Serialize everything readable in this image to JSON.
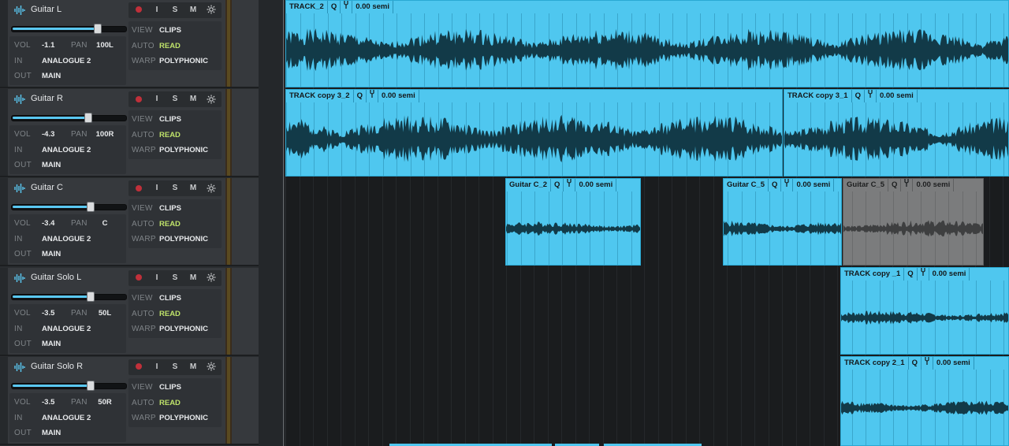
{
  "tracks": [
    {
      "name": "Guitar L",
      "vol_label": "VOL",
      "vol": "-1.1",
      "pan_label": "PAN",
      "pan": "100L",
      "in_label": "IN",
      "in": "ANALOGUE 2",
      "out_label": "OUT",
      "out": "MAIN",
      "view_label": "VIEW",
      "view": "CLIPS",
      "auto_label": "AUTO",
      "auto": "READ",
      "warp_label": "WARP",
      "warp": "POLYPHONIC",
      "buttons": {
        "i": "I",
        "s": "S",
        "m": "M"
      },
      "fader_level": 0.76
    },
    {
      "name": "Guitar R",
      "vol_label": "VOL",
      "vol": "-4.3",
      "pan_label": "PAN",
      "pan": "100R",
      "in_label": "IN",
      "in": "ANALOGUE 2",
      "out_label": "OUT",
      "out": "MAIN",
      "view_label": "VIEW",
      "view": "CLIPS",
      "auto_label": "AUTO",
      "auto": "READ",
      "warp_label": "WARP",
      "warp": "POLYPHONIC",
      "buttons": {
        "i": "I",
        "s": "S",
        "m": "M"
      },
      "fader_level": 0.68
    },
    {
      "name": "Guitar C",
      "vol_label": "VOL",
      "vol": "-3.4",
      "pan_label": "PAN",
      "pan": "C",
      "in_label": "IN",
      "in": "ANALOGUE 2",
      "out_label": "OUT",
      "out": "MAIN",
      "view_label": "VIEW",
      "view": "CLIPS",
      "auto_label": "AUTO",
      "auto": "READ",
      "warp_label": "WARP",
      "warp": "POLYPHONIC",
      "buttons": {
        "i": "I",
        "s": "S",
        "m": "M"
      },
      "fader_level": 0.7
    },
    {
      "name": "Guitar Solo L",
      "vol_label": "VOL",
      "vol": "-3.5",
      "pan_label": "PAN",
      "pan": "50L",
      "in_label": "IN",
      "in": "ANALOGUE 2",
      "out_label": "OUT",
      "out": "MAIN",
      "view_label": "VIEW",
      "view": "CLIPS",
      "auto_label": "AUTO",
      "auto": "READ",
      "warp_label": "WARP",
      "warp": "POLYPHONIC",
      "buttons": {
        "i": "I",
        "s": "S",
        "m": "M"
      },
      "fader_level": 0.7
    },
    {
      "name": "Guitar Solo R",
      "vol_label": "VOL",
      "vol": "-3.5",
      "pan_label": "PAN",
      "pan": "50R",
      "in_label": "IN",
      "in": "ANALOGUE 2",
      "out_label": "OUT",
      "out": "MAIN",
      "view_label": "VIEW",
      "view": "CLIPS",
      "auto_label": "AUTO",
      "auto": "READ",
      "warp_label": "WARP",
      "warp": "POLYPHONIC",
      "buttons": {
        "i": "I",
        "s": "S",
        "m": "M"
      },
      "fader_level": 0.7
    }
  ],
  "clips": [
    {
      "name": "TRACK_2",
      "q": "Q",
      "semi": "0.00 semi",
      "color": "blue"
    },
    {
      "name": "TRACK copy 3_2",
      "q": "Q",
      "semi": "0.00 semi",
      "color": "blue"
    },
    {
      "name": "TRACK copy 3_1",
      "q": "Q",
      "semi": "0.00 semi",
      "color": "blue"
    },
    {
      "name": "Guitar C_2",
      "q": "Q",
      "semi": "0.00 semi",
      "color": "blue"
    },
    {
      "name": "Guitar C_5",
      "q": "Q",
      "semi": "0.00 semi",
      "color": "blue"
    },
    {
      "name": "Guitar C_5",
      "q": "Q",
      "semi": "0.00 semi",
      "color": "grey"
    },
    {
      "name": "TRACK copy _1",
      "q": "Q",
      "semi": "0.00 semi",
      "color": "blue"
    },
    {
      "name": "TRACK copy 2_1",
      "q": "Q",
      "semi": "0.00 semi",
      "color": "blue"
    }
  ],
  "colors": {
    "clip": "#4fc7ef",
    "clip_grey": "#7b7c7d",
    "accent": "#5ac8f2",
    "auto_read": "#bfe36a",
    "record": "#c0303a"
  },
  "icons": {
    "track": "waveform-icon",
    "record": "record-dot-icon",
    "settings": "gear-icon",
    "tune": "tuning-fork-icon"
  }
}
